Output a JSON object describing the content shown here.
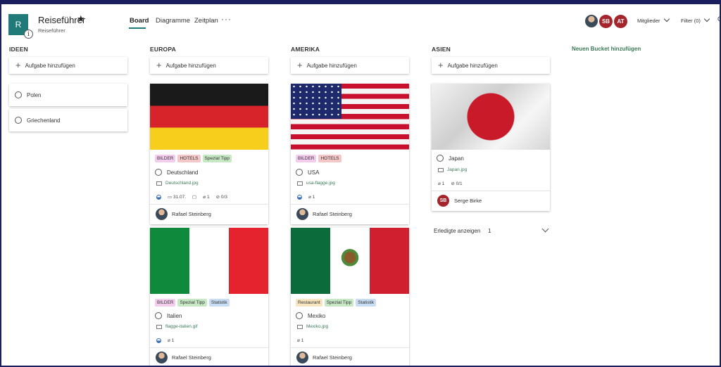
{
  "header": {
    "plan_initial": "R",
    "info_glyph": "i",
    "title": "Reiseführer",
    "star": "★",
    "subtitle": "Reiseführer",
    "tabs": [
      {
        "label": "Board"
      },
      {
        "label": "Diagramme"
      },
      {
        "label": "Zeitplan"
      }
    ],
    "more": "···",
    "avatars": [
      {
        "initials": "SB"
      },
      {
        "initials": "AT"
      }
    ],
    "members_label": "Mitglieder",
    "filter_label": "Filter (0)",
    "extra": "G"
  },
  "buckets": [
    {
      "title": "IDEEN",
      "add_label": "Aufgabe hinzufügen"
    },
    {
      "title": "EUROPA",
      "add_label": "Aufgabe hinzufügen"
    },
    {
      "title": "AMERIKA",
      "add_label": "Aufgabe hinzufügen"
    },
    {
      "title": "ASIEN",
      "add_label": "Aufgabe hinzufügen"
    }
  ],
  "new_bucket_label": "Neuen Bucket hinzufügen",
  "ideen_tasks": [
    "Polen",
    "Griechenland"
  ],
  "cards": {
    "deutschland": {
      "labels": [
        "BILDER",
        "HOTELS",
        "Spezial Tipp"
      ],
      "name": "Deutschland",
      "file": "Deutschland.jpg",
      "date": "31.07.",
      "attachments": "1",
      "checklist": "0/3",
      "assignee": "Rafael Steinberg"
    },
    "usa": {
      "labels": [
        "BILDER",
        "HOTELS"
      ],
      "name": "USA",
      "file": "usa-flagge.jpg",
      "attachments": "1",
      "assignee": "Rafael Steinberg"
    },
    "japan": {
      "name": "Japan",
      "file": "Japan.jpg",
      "attachments": "1",
      "checklist": "0/1",
      "assignee_initials": "SB",
      "assignee": "Serge Birke"
    },
    "italien": {
      "labels": [
        "BILDER",
        "Spezial Tipp",
        "Statistik"
      ],
      "name": "Italien",
      "file": "flagge-italien.gif",
      "attachments": "1",
      "assignee": "Rafael Steinberg"
    },
    "mexiko": {
      "labels": [
        "Restaurant",
        "Spezial Tipp",
        "Statistik"
      ],
      "name": "Mexiko",
      "file": "Mexiko.jpg",
      "attachments": "1",
      "assignee": "Rafael Steinberg"
    }
  },
  "completed": {
    "label": "Erledigte anzeigen",
    "count": "1"
  },
  "colors": {
    "accent": "#1f7a78",
    "avatar_red": "#a4262c",
    "frame": "#1b1f5e",
    "link_green": "#3c7a57"
  },
  "icons": [
    "info-icon",
    "star-icon",
    "more-icon",
    "chevron-down-icon",
    "plus-icon",
    "circle-checkbox-icon",
    "image-icon",
    "progress-icon",
    "calendar-icon",
    "comment-icon",
    "paperclip-icon",
    "checklist-icon"
  ]
}
